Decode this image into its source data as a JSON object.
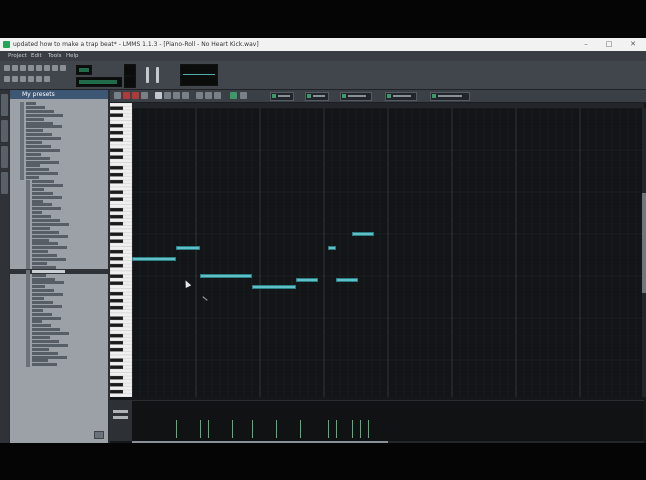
{
  "window": {
    "title": "updated how to make a trap beat* - LMMS 1.1.3 - [Piano-Roll - No Heart Kick.wav]",
    "controls": [
      "–",
      "□",
      "✕"
    ]
  },
  "menu": [
    "Project",
    "Edit",
    "Tools",
    "Help"
  ],
  "sidebar": {
    "header": "My presets",
    "item_count": 68,
    "selected_index": 43
  },
  "piano_roll": {
    "notes": [
      {
        "start": 0,
        "length": 5.5,
        "pitch": 5
      },
      {
        "start": 5.5,
        "length": 3,
        "pitch": 8
      },
      {
        "start": 8.5,
        "length": 6.5,
        "pitch": 0
      },
      {
        "start": 15,
        "length": 5.5,
        "pitch": -3
      },
      {
        "start": 20.5,
        "length": 2.8,
        "pitch": -1
      },
      {
        "start": 24.5,
        "length": 1,
        "pitch": 8
      },
      {
        "start": 25.5,
        "length": 2.8,
        "pitch": -1
      },
      {
        "start": 27.5,
        "length": 2.8,
        "pitch": 12
      }
    ],
    "velocity_positions": [
      5.5,
      8.5,
      9.5,
      12.5,
      15,
      18,
      21,
      24.5,
      25.5,
      27.5,
      28.5,
      29.5
    ],
    "grid_columns": 64
  },
  "colors": {
    "note_fill": "#5fc0c8",
    "velocity_bar": "#4fb37a",
    "accent": "#3d5674"
  }
}
